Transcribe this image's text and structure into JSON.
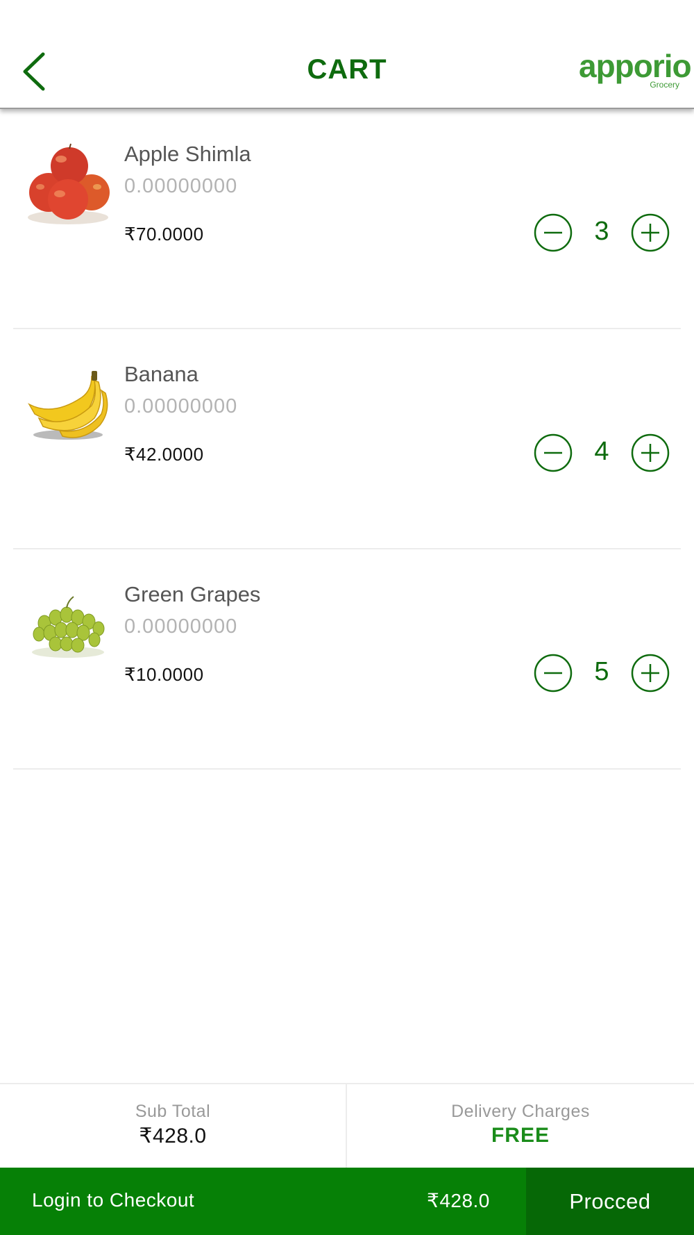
{
  "header": {
    "title": "CART",
    "logo_text": "apporio",
    "logo_subtext": "Grocery",
    "back_icon": "chevron-left-icon"
  },
  "colors": {
    "primary_green": "#0e6b0e",
    "bar_green": "#068006",
    "proceed_green": "#066806",
    "logo_green": "#3d9a35",
    "free_green": "#1a8c1a"
  },
  "cart": {
    "items": [
      {
        "name": "Apple Shimla",
        "subtext": "0.00000000",
        "price": "₹70.0000",
        "quantity": "3",
        "image": "apples-image"
      },
      {
        "name": "Banana",
        "subtext": "0.00000000",
        "price": "₹42.0000",
        "quantity": "4",
        "image": "bananas-image"
      },
      {
        "name": "Green Grapes",
        "subtext": "0.00000000",
        "price": "₹10.0000",
        "quantity": "5",
        "image": "green-grapes-image"
      }
    ]
  },
  "summary": {
    "subtotal_label": "Sub Total",
    "subtotal_value": "₹428.0",
    "delivery_label": "Delivery Charges",
    "delivery_value": "FREE"
  },
  "checkout": {
    "login_label": "Login to Checkout",
    "total": "₹428.0",
    "proceed_label": "Procced"
  }
}
